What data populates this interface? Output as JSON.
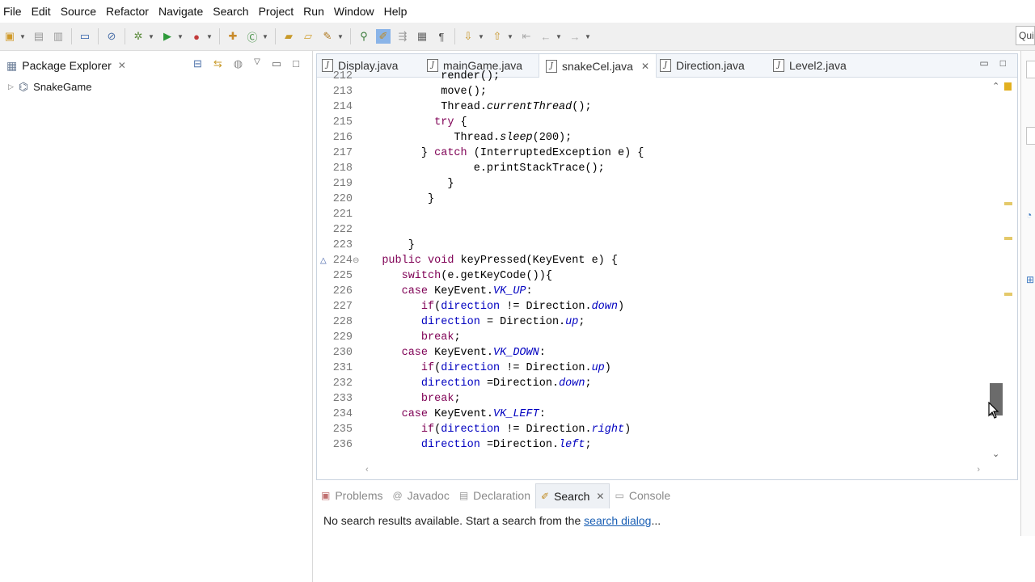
{
  "menubar": [
    "File",
    "Edit",
    "Source",
    "Refactor",
    "Navigate",
    "Search",
    "Project",
    "Run",
    "Window",
    "Help"
  ],
  "toolbar": {
    "quick_access": "Qui"
  },
  "package_explorer": {
    "tab_label": "Package Explorer",
    "project": "SnakeGame"
  },
  "editor": {
    "tabs": [
      {
        "label": "Display.java",
        "active": false
      },
      {
        "label": "mainGame.java",
        "active": false
      },
      {
        "label": "snakeCel.java",
        "active": true
      },
      {
        "label": "Direction.java",
        "active": false
      },
      {
        "label": "Level2.java",
        "active": false
      }
    ],
    "lines": [
      {
        "n": "212",
        "t": "            render();"
      },
      {
        "n": "213",
        "t": "            move();"
      },
      {
        "n": "214",
        "t": "            Thread.currentThread();"
      },
      {
        "n": "215",
        "t": "           try {"
      },
      {
        "n": "216",
        "t": "              Thread.sleep(200);"
      },
      {
        "n": "217",
        "t": "         } catch (InterruptedException e) {"
      },
      {
        "n": "218",
        "t": "                 e.printStackTrace();"
      },
      {
        "n": "219",
        "t": "             }"
      },
      {
        "n": "220",
        "t": "          }"
      },
      {
        "n": "221",
        "t": ""
      },
      {
        "n": "222",
        "t": ""
      },
      {
        "n": "223",
        "t": "       }"
      },
      {
        "n": "224",
        "t": "   public void keyPressed(KeyEvent e) {"
      },
      {
        "n": "225",
        "t": "      switch(e.getKeyCode()){"
      },
      {
        "n": "226",
        "t": "      case KeyEvent.VK_UP:"
      },
      {
        "n": "227",
        "t": "         if(direction != Direction.down)"
      },
      {
        "n": "228",
        "t": "         direction = Direction.up;"
      },
      {
        "n": "229",
        "t": "         break;"
      },
      {
        "n": "230",
        "t": "      case KeyEvent.VK_DOWN:"
      },
      {
        "n": "231",
        "t": "         if(direction != Direction.up)"
      },
      {
        "n": "232",
        "t": "         direction =Direction.down;"
      },
      {
        "n": "233",
        "t": "         break;"
      },
      {
        "n": "234",
        "t": "      case KeyEvent.VK_LEFT:"
      },
      {
        "n": "235",
        "t": "         if(direction != Direction.right)"
      },
      {
        "n": "236",
        "t": "         direction =Direction.left;"
      }
    ]
  },
  "bottom_panel": {
    "tabs": [
      {
        "label": "Problems",
        "active": false
      },
      {
        "label": "Javadoc",
        "active": false
      },
      {
        "label": "Declaration",
        "active": false
      },
      {
        "label": "Search",
        "active": true
      },
      {
        "label": "Console",
        "active": false
      }
    ],
    "message": "No search results available. Start a search from the ",
    "link": "search dialog",
    "suffix": "..."
  }
}
